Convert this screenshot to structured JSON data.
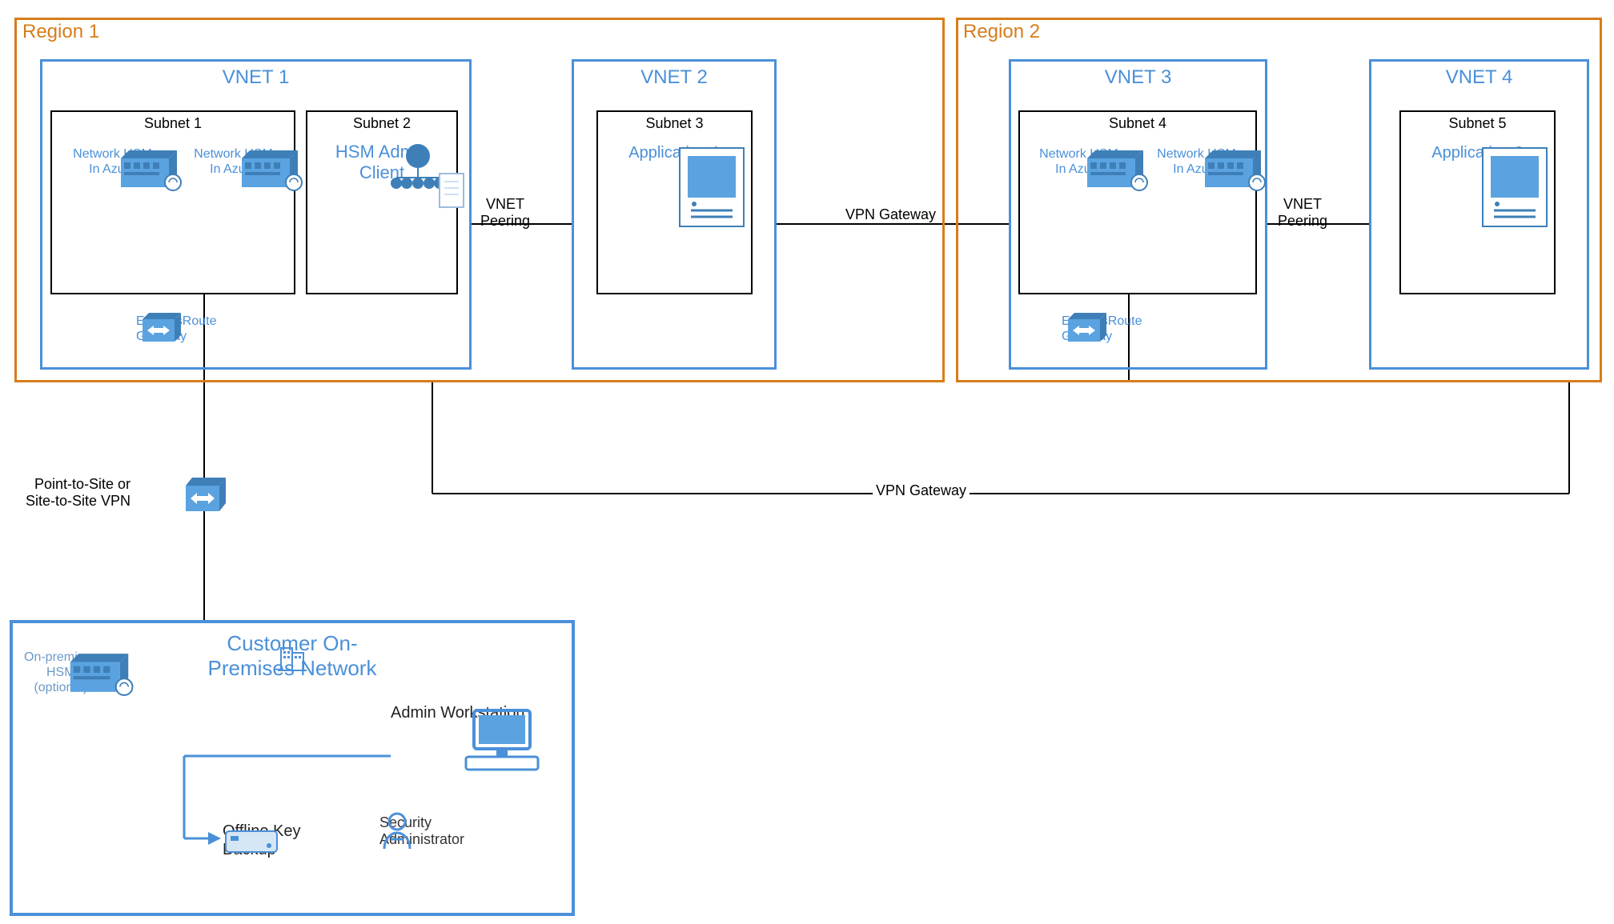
{
  "regions": {
    "region1": {
      "label": "Region 1"
    },
    "region2": {
      "label": "Region 2"
    }
  },
  "vnets": {
    "vnet1": {
      "label": "VNET 1"
    },
    "vnet2": {
      "label": "VNET 2"
    },
    "vnet3": {
      "label": "VNET 3"
    },
    "vnet4": {
      "label": "VNET 4"
    }
  },
  "subnets": {
    "subnet1": {
      "label": "Subnet 1",
      "hsm_a": "Network HSM\nIn Azure",
      "hsm_b": "Network HSM\nIn Azure"
    },
    "subnet2": {
      "label": "Subnet 2",
      "content_label": "HSM Admin\nClient"
    },
    "subnet3": {
      "label": "Subnet 3",
      "content_label": "Application 1"
    },
    "subnet4": {
      "label": "Subnet 4",
      "hsm_a": "Network HSM\nIn Azure",
      "hsm_b": "Network HSM\nIn Azure"
    },
    "subnet5": {
      "label": "Subnet 5",
      "content_label": "Application 2"
    }
  },
  "gateways": {
    "expressroute1": "ExpressRoute\nGateway",
    "expressroute2": "ExpressRoute\nGateway",
    "p2s_label": "Point-to-Site or\nSite-to-Site VPN"
  },
  "connections": {
    "vnet_peering1": "VNET\nPeering",
    "vnet_peering2": "VNET\nPeering",
    "vpn_gateway1": "VPN Gateway",
    "vpn_gateway2": "VPN Gateway"
  },
  "onprem": {
    "title": "Customer On-\nPremises Network",
    "hsm_label": "On-premises\nHSM\n(optional)",
    "admin_workstation": "Admin Workstation",
    "security_admin": "Security\nAdministrator",
    "offline_key_backup": "Offline Key\nBackup"
  }
}
